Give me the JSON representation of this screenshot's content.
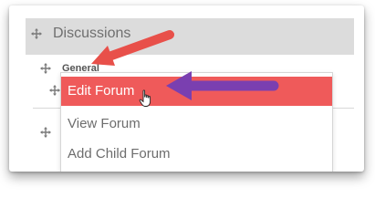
{
  "section": {
    "title": "Discussions",
    "row_label": "General"
  },
  "menu": {
    "items": [
      {
        "label": "Edit Forum",
        "active": true
      },
      {
        "label": "View Forum",
        "active": false
      },
      {
        "label": "Add Child Forum",
        "active": false
      }
    ]
  },
  "colors": {
    "highlight": "#ef5a5a",
    "arrow_red": "#e8504a",
    "arrow_purple": "#7a3fb0"
  },
  "icons": {
    "drag_handle": "move-icon",
    "cursor": "hand-pointer-icon"
  }
}
